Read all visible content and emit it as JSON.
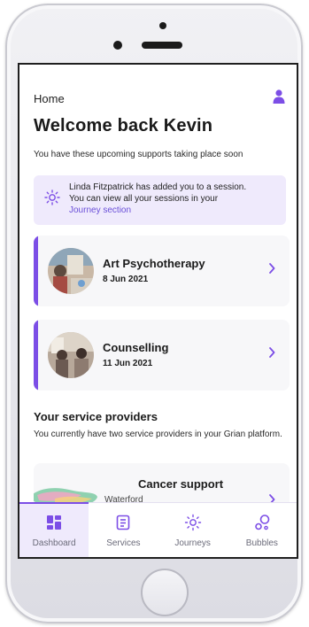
{
  "header": {
    "breadcrumb": "Home",
    "profile_icon": "user-icon"
  },
  "welcome": {
    "title": "Welcome back Kevin",
    "subtitle": "You have these upcoming supports taking place soon"
  },
  "notice": {
    "icon": "sun-icon",
    "line1": "Linda Fitzpatrick has added you to a session.",
    "line2": "You can view all your sessions in your",
    "link": "Journey section"
  },
  "sessions": [
    {
      "name": "Art Psychotherapy",
      "date": "8 Jun 2021"
    },
    {
      "name": "Counselling",
      "date": "11 Jun 2021"
    }
  ],
  "providers": {
    "title": "Your service providers",
    "subtitle": "You currently have two service providers in your Grian platform.",
    "items": [
      {
        "name": "Cancer support",
        "location": "Waterford"
      }
    ]
  },
  "tabs": [
    {
      "label": "Dashboard",
      "icon": "dashboard-icon",
      "active": true
    },
    {
      "label": "Services",
      "icon": "services-icon",
      "active": false
    },
    {
      "label": "Journeys",
      "icon": "journeys-icon",
      "active": false
    },
    {
      "label": "Bubbles",
      "icon": "bubbles-icon",
      "active": false
    }
  ],
  "colors": {
    "accent": "#7c4ee6",
    "notice_bg": "#efeafc",
    "link": "#6a4fd8"
  }
}
